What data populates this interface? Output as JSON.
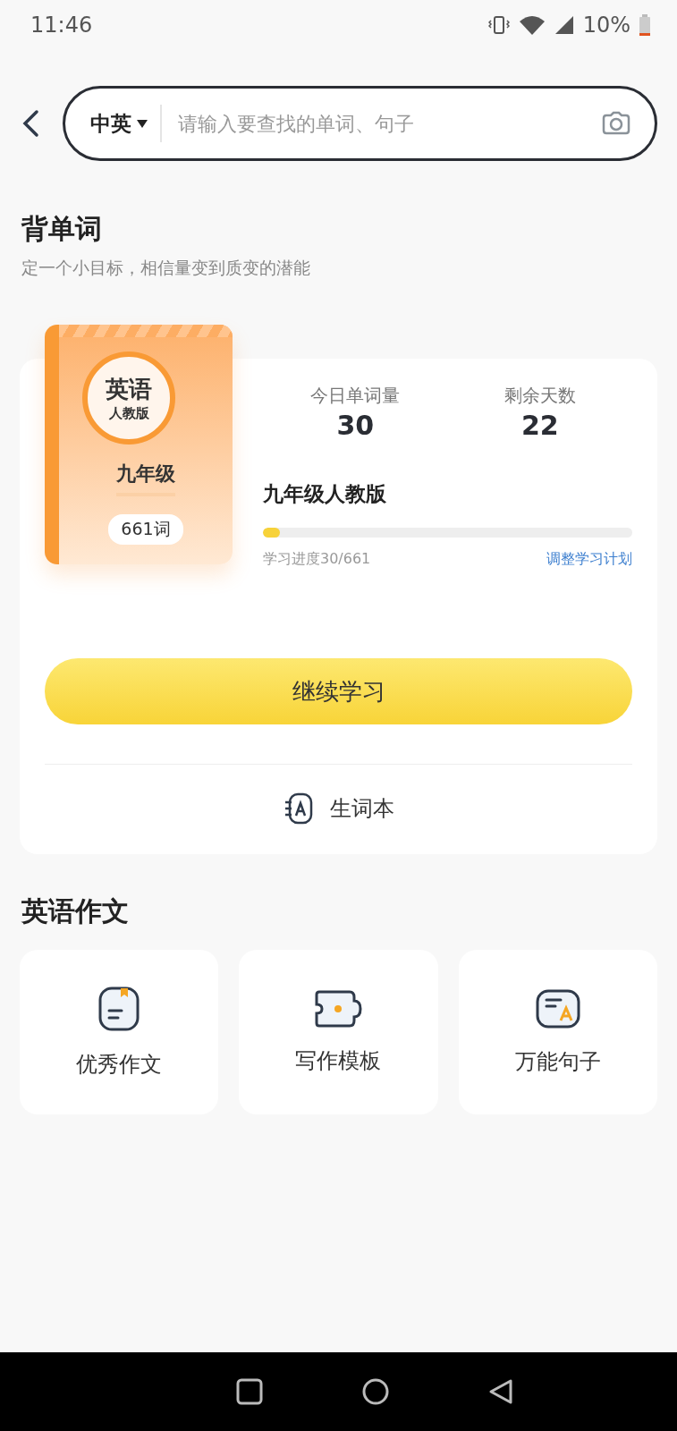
{
  "status_bar": {
    "time": "11:46",
    "battery": "10%"
  },
  "search": {
    "language": "中英",
    "placeholder": "请输入要查找的单词、句子"
  },
  "vocab": {
    "title": "背单词",
    "subtitle": "定一个小目标，相信量变到质变的潜能",
    "book": {
      "subject": "英语",
      "edition": "人教版",
      "grade": "九年级",
      "count": "661词"
    },
    "stats": [
      {
        "label": "今日单词量",
        "value": "30"
      },
      {
        "label": "剩余天数",
        "value": "22"
      }
    ],
    "plan_title": "九年级人教版",
    "level": 0.045,
    "progress_text": "学习进度30/661",
    "adjust_link": "调整学习计划",
    "continue_button": "继续学习",
    "wordbook": "生词本"
  },
  "essay": {
    "title": "英语作文",
    "items": [
      {
        "kind": "doc",
        "label": "优秀作文"
      },
      {
        "kind": "puzzle",
        "label": "写作模板"
      },
      {
        "kind": "letter",
        "label": "万能句子"
      }
    ]
  }
}
